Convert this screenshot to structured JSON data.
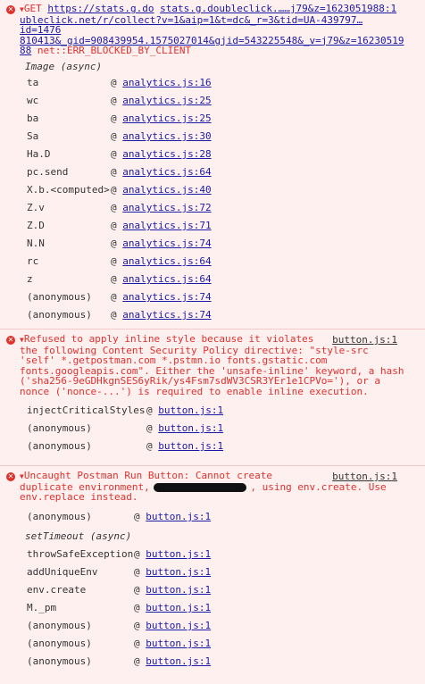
{
  "msg1": {
    "prefix": "GET ",
    "url1": "https://stats.g.do",
    "url1b": "stats.g.doubleclick.…",
    "url1c": "…j79&z=1623051988:1",
    "line2": "ubleclick.net/r/collect?v=1&aip=1&t=dc&_r=3&tid=UA-439797…id=1476",
    "line3": "810413&_gid=908439954.1575027014&gjid=543225548&_v=j79&z=16230519",
    "line4a": "88",
    "line4b": " net::ERR_BLOCKED_BY_CLIENT",
    "async_label": "Image (async)",
    "frames": [
      {
        "fn": "ta",
        "src": "analytics.js:16"
      },
      {
        "fn": "wc",
        "src": "analytics.js:25"
      },
      {
        "fn": "ba",
        "src": "analytics.js:25"
      },
      {
        "fn": "Sa",
        "src": "analytics.js:30"
      },
      {
        "fn": "Ha.D",
        "src": "analytics.js:28"
      },
      {
        "fn": "pc.send",
        "src": "analytics.js:64"
      },
      {
        "fn": "X.b.<computed>",
        "src": "analytics.js:40"
      },
      {
        "fn": "Z.v",
        "src": "analytics.js:72"
      },
      {
        "fn": "Z.D",
        "src": "analytics.js:71"
      },
      {
        "fn": "N.N",
        "src": "analytics.js:74"
      },
      {
        "fn": "rc",
        "src": "analytics.js:64"
      },
      {
        "fn": "z",
        "src": "analytics.js:64"
      },
      {
        "fn": "(anonymous)",
        "src": "analytics.js:74"
      },
      {
        "fn": "(anonymous)",
        "src": "analytics.js:74"
      }
    ]
  },
  "msg2": {
    "source": "button.js:1",
    "lines": [
      "Refused to apply inline style because it violates",
      "the following Content Security Policy directive: \"style-src",
      "'self' *.getpostman.com *.pstmn.io fonts.gstatic.com",
      "fonts.googleapis.com\". Either the 'unsafe-inline' keyword, a hash",
      "('sha256-9eGDHkgnSES6yRik/ys4Fsm7sdWV3CSR3YEr1e1CPVo='), or a",
      "nonce ('nonce-...') is required to enable inline execution."
    ],
    "frames": [
      {
        "fn": "injectCriticalStyles",
        "src": "button.js:1"
      },
      {
        "fn": "(anonymous)",
        "src": "button.js:1"
      },
      {
        "fn": "(anonymous)",
        "src": "button.js:1"
      }
    ]
  },
  "msg3": {
    "source": "button.js:1",
    "line1": "Uncaught Postman Run Button: Cannot create",
    "line2a": "duplicate environment, ",
    "line2b": ", using env.create. Use",
    "line3": "env.replace instead.",
    "frame0": {
      "fn": "(anonymous)",
      "src": "button.js:1"
    },
    "async_label": "setTimeout (async)",
    "frames": [
      {
        "fn": "throwSafeException",
        "src": "button.js:1"
      },
      {
        "fn": "addUniqueEnv",
        "src": "button.js:1"
      },
      {
        "fn": "env.create",
        "src": "button.js:1"
      },
      {
        "fn": "M._pm",
        "src": "button.js:1"
      },
      {
        "fn": "(anonymous)",
        "src": "button.js:1"
      },
      {
        "fn": "(anonymous)",
        "src": "button.js:1"
      },
      {
        "fn": "(anonymous)",
        "src": "button.js:1"
      }
    ]
  }
}
